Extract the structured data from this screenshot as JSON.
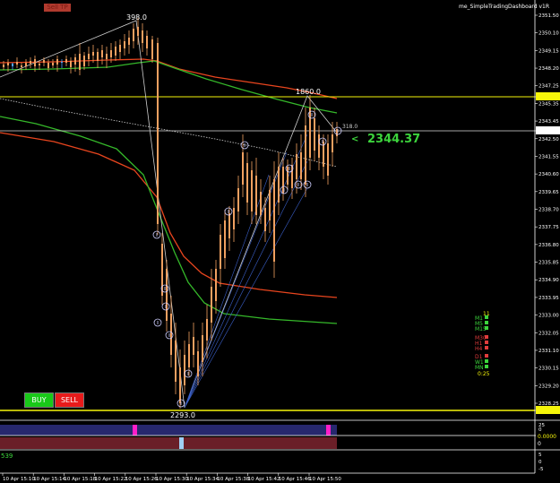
{
  "window": {
    "indicator_title": "me_SimpleTradingDashboard v1R",
    "top_left_box": "Sell TP"
  },
  "price_axis": {
    "labels": [
      "2351.50",
      "2350.10",
      "2349.15",
      "2348.20",
      "2347.25",
      "2346.30",
      "2345.35",
      "2344.37",
      "2343.45",
      "2342.50",
      "2341.55",
      "2340.60",
      "2339.65",
      "2338.70",
      "2337.75",
      "2336.80",
      "2335.85",
      "2334.90",
      "2333.95",
      "2333.00",
      "2332.05",
      "2331.10",
      "2330.15",
      "2329.20",
      "2328.25",
      "2327.53"
    ]
  },
  "annotations": {
    "top_left_peak": "398.0",
    "right_peak": "1860.0",
    "bottom_low": "2293.0",
    "current_price_arrow": "<",
    "current_price": "2344.37",
    "small_label": "318.0"
  },
  "dashboard": {
    "count": "11",
    "timeframes": [
      {
        "label": "M1",
        "color": "#3cd43c"
      },
      {
        "label": "M5",
        "color": "#3cd43c"
      },
      {
        "label": "M15",
        "color": "#3cd43c"
      },
      {
        "label": "M30",
        "color": "#e03c3c"
      },
      {
        "label": "H1",
        "color": "#e03c3c"
      },
      {
        "label": "H4",
        "color": "#e03c3c"
      },
      {
        "label": "D1",
        "color": "#e03c3c"
      },
      {
        "label": "W1",
        "color": "#3cd43c"
      },
      {
        "label": "MN",
        "color": "#3cd43c"
      }
    ],
    "timer": "0:25"
  },
  "buttons": {
    "buy": "BUY",
    "sell": "SELL"
  },
  "sub_panel_1": {
    "levels": [
      "25",
      "0",
      "-25"
    ]
  },
  "sub_panel_2": {
    "value_label": "0.0000",
    "levels": [
      "0"
    ]
  },
  "sub_panel_3": {
    "left_value": "539",
    "levels": [
      "5",
      "0",
      "-5"
    ]
  },
  "time_axis": {
    "labels": [
      "10 Apr 15:10",
      "10 Apr 15:14",
      "10 Apr 15:18",
      "10 Apr 15:22",
      "10 Apr 15:26",
      "10 Apr 15:30",
      "10 Apr 15:34",
      "10 Apr 15:38",
      "10 Apr 15:42",
      "10 Apr 15:46",
      "10 Apr 15:50"
    ]
  },
  "colors": {
    "bull": "#4fa3ff",
    "bear": "#f0a060",
    "ma_red": "#e8451e",
    "ma_green": "#35b82a",
    "yellow_line": "#f5f50a",
    "white_line": "#ffffff",
    "buy_bg": "#19c919",
    "sell_bg": "#e81b1b"
  }
}
